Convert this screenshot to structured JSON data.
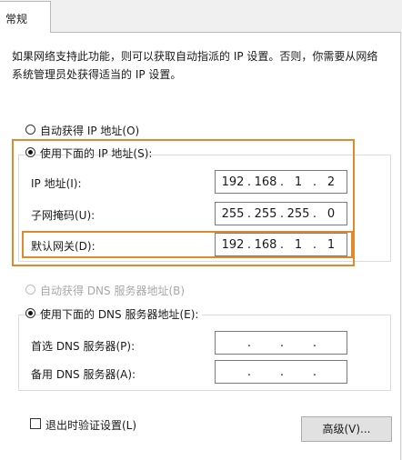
{
  "tab": {
    "label": "常规"
  },
  "description": "如果网络支持此功能，则可以获取自动指派的 IP 设置。否则，你需要从网络系统管理员处获得适当的 IP 设置。",
  "ip": {
    "auto_label": "自动获得 IP 地址(O)",
    "manual_label": "使用下面的 IP 地址(S):",
    "selected": "manual",
    "fields": [
      {
        "label": "IP 地址(I):",
        "octets": [
          "192",
          "168",
          "1",
          "2"
        ]
      },
      {
        "label": "子网掩码(U):",
        "octets": [
          "255",
          "255",
          "255",
          "0"
        ]
      },
      {
        "label": "默认网关(D):",
        "octets": [
          "192",
          "168",
          "1",
          "1"
        ]
      }
    ]
  },
  "dns": {
    "auto_label": "自动获得 DNS 服务器地址(B)",
    "manual_label": "使用下面的 DNS 服务器地址(E):",
    "selected": "manual",
    "fields": [
      {
        "label": "首选 DNS 服务器(P):",
        "octets": [
          "",
          "",
          "",
          ""
        ]
      },
      {
        "label": "备用 DNS 服务器(A):",
        "octets": [
          "",
          "",
          "",
          ""
        ]
      }
    ]
  },
  "validate_label": "退出时验证设置(L)",
  "advanced_button": "高级(V)...",
  "highlight_color": "#e08a2e"
}
